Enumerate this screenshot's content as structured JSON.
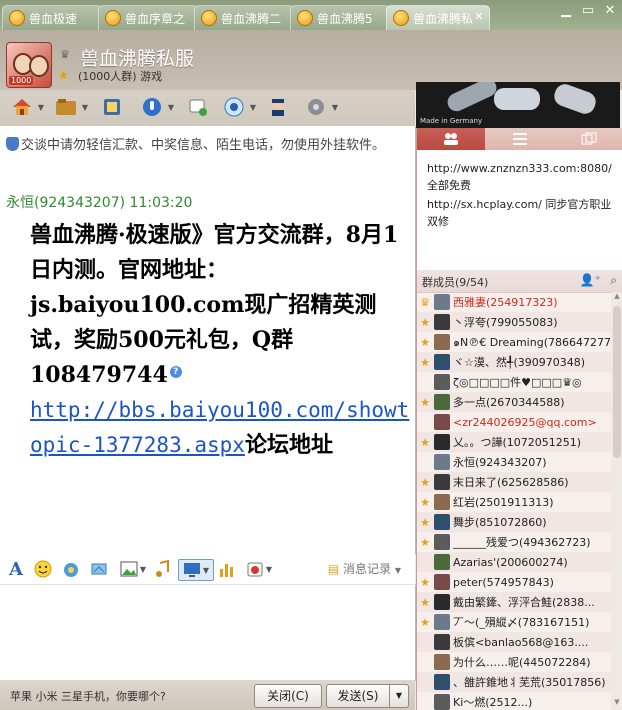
{
  "tabs": [
    {
      "label": "兽血极速"
    },
    {
      "label": "兽血序章之"
    },
    {
      "label": "兽血沸腾二"
    },
    {
      "label": "兽血沸腾5"
    },
    {
      "label": "兽血沸腾私"
    }
  ],
  "header": {
    "title": "兽血沸腾私服",
    "subtitle": "(1000人群) 游戏",
    "avatar_badge": "1000"
  },
  "ad": {
    "text": "Made in Germany"
  },
  "chat": {
    "notice": "交谈中请勿轻信汇款、中奖信息、陌生电话，勿使用外挂软件。",
    "sender": "永恒(924343207)  11:03:20",
    "message_text": "兽血沸腾·极速版》官方交流群，8月1日内测。官网地址：js.baiyou100.com现广招精英测试，奖励500元礼包，Q群108479744",
    "link": "http://bbs.baiyou100.com/showtopic-1377283.aspx",
    "message_tail": "论坛地址"
  },
  "format_bar": {
    "history_label": "消息记录"
  },
  "bottom": {
    "tip": "苹果 小米 三星手机，你要哪个?",
    "close_label": "关闭(C)",
    "send_label": "发送(S)"
  },
  "announcement": {
    "line1": "http://www.znznzn333.com:8080/ 全部免费",
    "line2": "http://sx.hcplay.com/ 同步官方职业双修"
  },
  "members_header": "群成员(9/54)",
  "members": [
    {
      "name": "西雅妻(254917323)",
      "role": "owner",
      "highlight": true
    },
    {
      "name": "丶浮夸(799055083)",
      "role": "admin"
    },
    {
      "name": "๑N℗€ Dreaming(786647277)",
      "role": "admin"
    },
    {
      "name": "ヾ☆漠、然╃(390970348)",
      "role": "admin"
    },
    {
      "name": "ζ◎□□□□件♥□□□♛◎",
      "role": ""
    },
    {
      "name": "多一点(2670344588)",
      "role": "admin"
    },
    {
      "name": "<zr244026925@qq.com>",
      "role": "",
      "highlight": true
    },
    {
      "name": "乂。。つ譁(1072051251)",
      "role": "admin"
    },
    {
      "name": "永恒(924343207)",
      "role": ""
    },
    {
      "name": "末日来了(625628586)",
      "role": "admin"
    },
    {
      "name": "红岩(2501911313)",
      "role": "admin"
    },
    {
      "name": "舞步(851072860)",
      "role": "admin"
    },
    {
      "name": "______残爱つ(494362723)",
      "role": "admin"
    },
    {
      "name": "Azarias'(200600274)",
      "role": ""
    },
    {
      "name": "peter(574957843)",
      "role": "admin"
    },
    {
      "name": "戴由繁鏲、浮泙合鮭(2838...",
      "role": "admin"
    },
    {
      "name": "丆～(_殞縱〆(783167151)",
      "role": "admin"
    },
    {
      "name": "板傧<banlao568@163....",
      "role": ""
    },
    {
      "name": "为什么……呢(445072284)",
      "role": ""
    },
    {
      "name": "、雒許錐地丬芜荒(35017856)",
      "role": ""
    },
    {
      "name": "Ki～燃(2512...)",
      "role": ""
    }
  ],
  "colors": {
    "accent": "#b84b43",
    "link": "#1a55c7",
    "sender": "#2f8a2f"
  }
}
